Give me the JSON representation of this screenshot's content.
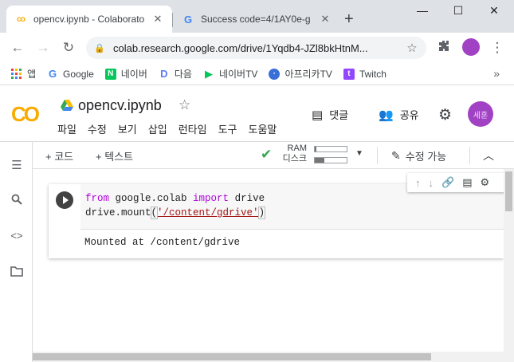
{
  "browser": {
    "tabs": [
      {
        "title": "opencv.ipynb - Colaborato",
        "active": true
      },
      {
        "title": "Success code=4/1AY0e-g",
        "active": false
      }
    ],
    "close_glyph": "✕",
    "new_tab_glyph": "+",
    "window_controls": {
      "minimize": "—",
      "maximize": "☐",
      "close": "✕"
    },
    "url": "colab.research.google.com/drive/1Yqdb4-JZl8bkHtnM...",
    "bookmarks": [
      {
        "label": "앱",
        "icon": "apps-grid-icon"
      },
      {
        "label": "Google",
        "icon": "google-icon"
      },
      {
        "label": "네이버",
        "icon": "naver-icon"
      },
      {
        "label": "다음",
        "icon": "daum-icon"
      },
      {
        "label": "네이버TV",
        "icon": "navertv-icon"
      },
      {
        "label": "아프리카TV",
        "icon": "afreecatv-icon"
      },
      {
        "label": "Twitch",
        "icon": "twitch-icon"
      }
    ],
    "bookmarks_more": "»"
  },
  "colab": {
    "logo": "CO",
    "notebook_title": "opencv.ipynb",
    "menu": [
      "파일",
      "수정",
      "보기",
      "삽입",
      "런타임",
      "도구",
      "도움말"
    ],
    "comments_label": "댓글",
    "share_label": "공유",
    "avatar_initials": "세훈",
    "toolbar": {
      "add_code": "+ 코드",
      "add_text": "+ 텍스트",
      "ram_label": "RAM",
      "disk_label": "디스크",
      "ram_usage": 0.05,
      "disk_usage": 0.3,
      "edit_mode": "수정 가능"
    },
    "cell": {
      "code_line1": {
        "kw1": "from",
        "mod": " google.colab ",
        "kw2": "import",
        "rest": " drive"
      },
      "code_line2": {
        "prefix": "drive.mount",
        "open": "(",
        "string": "'/content/gdrive'",
        "close": ")"
      },
      "output": "Mounted at /content/gdrive"
    }
  },
  "colors": {
    "accent_orange": "#f9ab00",
    "keyword_purple": "#af00db",
    "string_red": "#a31515",
    "check_green": "#34a853",
    "avatar_purple": "#a142c4"
  }
}
